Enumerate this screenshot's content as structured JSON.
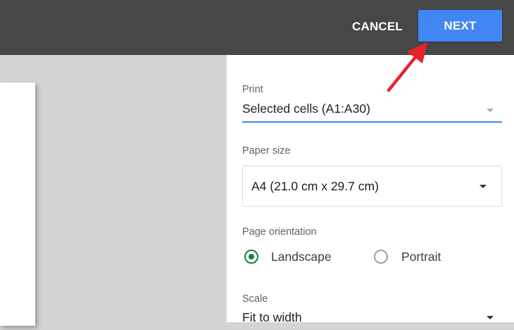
{
  "header": {
    "cancel_label": "CANCEL",
    "next_label": "NEXT"
  },
  "settings": {
    "print": {
      "label": "Print",
      "value": "Selected cells (A1:A30)"
    },
    "paper_size": {
      "label": "Paper size",
      "value": "A4 (21.0 cm x 29.7 cm)"
    },
    "orientation": {
      "label": "Page orientation",
      "options": [
        {
          "label": "Landscape",
          "selected": true
        },
        {
          "label": "Portrait",
          "selected": false
        }
      ]
    },
    "scale": {
      "label": "Scale",
      "value": "Fit to width"
    }
  },
  "colors": {
    "topbar": "#474747",
    "accent": "#4285f4",
    "radio_selected": "#188038",
    "annotation_arrow": "#e8212b"
  }
}
